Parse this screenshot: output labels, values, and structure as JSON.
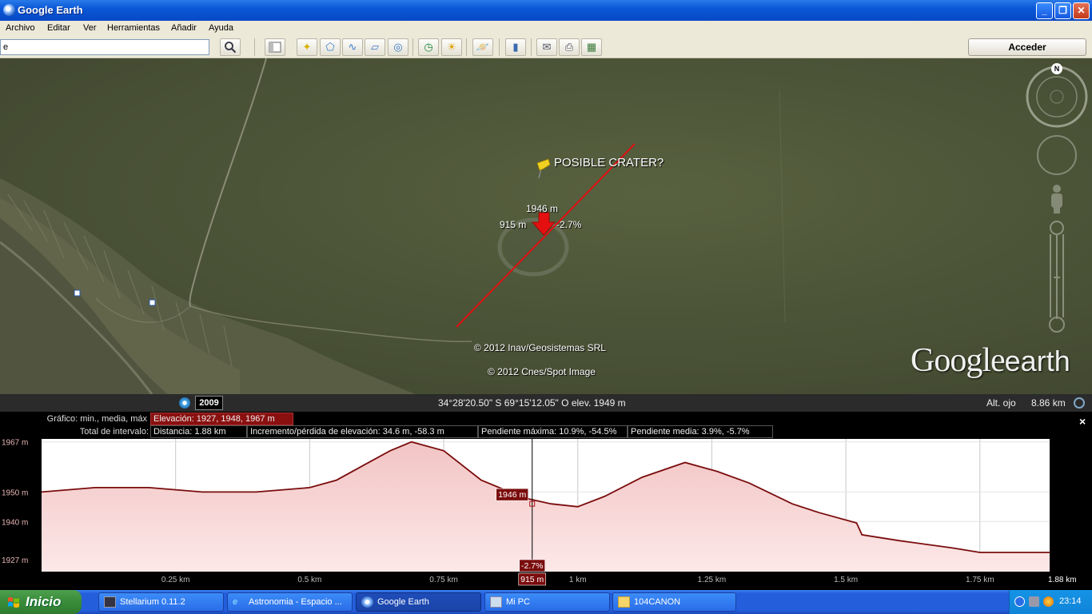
{
  "window": {
    "title": "Google Earth",
    "controls": [
      "_",
      "❐",
      "✕"
    ]
  },
  "menu": [
    "Archivo",
    "Editar",
    "Ver",
    "Herramientas",
    "Añadir",
    "Ayuda"
  ],
  "toolbar": {
    "search_value": "e",
    "signin_label": "Acceder"
  },
  "map": {
    "placemark_label": "POSIBLE CRATER?",
    "cursor_elevation": "1946 m",
    "cursor_distance": "915 m",
    "cursor_slope": "-2.7%",
    "copyright_1": "© 2012 Inav/Geosistemas SRL",
    "copyright_2": "© 2012 Cnes/Spot Image",
    "brand_google": "Google",
    "brand_earth": "earth",
    "compass_north": "N"
  },
  "status": {
    "year": "2009",
    "coordinates": "34°28'20.50\" S  69°15'12.05\" O elev.  1949 m",
    "eye_alt_label": "Alt. ojo",
    "eye_alt_value": "8.86 km"
  },
  "profile": {
    "graph_label": "Gráfico: min., media, máx",
    "elevation_stats": "Elevación: 1927, 1948, 1967 m",
    "range_label": "Total de intervalo:",
    "distance": "Distancia: 1.88 km",
    "gain_loss": "Incremento/pérdida de elevación: 34.6 m, -58.3 m",
    "max_slope": "Pendiente máxima: 10.9%, -54.5%",
    "avg_slope": "Pendiente media: 3.9%, -5.7%",
    "close_label": "×",
    "cursor_elevation": "1946 m",
    "cursor_slope": "-2.7%",
    "cursor_distance": "915 m"
  },
  "chart_data": {
    "type": "area",
    "xlabel": "",
    "ylabel": "",
    "x_ticks": [
      {
        "value": 0.25,
        "label": "0.25 km"
      },
      {
        "value": 0.5,
        "label": "0.5 km"
      },
      {
        "value": 0.75,
        "label": "0.75 km"
      },
      {
        "value": 1.0,
        "label": "1 km"
      },
      {
        "value": 1.25,
        "label": "1.25 km"
      },
      {
        "value": 1.5,
        "label": "1.5 km"
      },
      {
        "value": 1.75,
        "label": "1.75 km"
      },
      {
        "value": 1.88,
        "label": "1.88 km"
      }
    ],
    "y_ticks": [
      {
        "value": 1967,
        "label": "1967 m"
      },
      {
        "value": 1950,
        "label": "1950 m"
      },
      {
        "value": 1940,
        "label": "1940 m"
      },
      {
        "value": 1927,
        "label": "1927 m"
      }
    ],
    "xlim": [
      0,
      1.88
    ],
    "ylim": [
      1923,
      1968
    ],
    "series": [
      {
        "x": [
          0,
          0.1,
          0.2,
          0.3,
          0.4,
          0.5,
          0.55,
          0.6,
          0.65,
          0.69,
          0.75,
          0.82,
          0.9,
          0.95,
          1.0,
          1.05,
          1.12,
          1.2,
          1.26,
          1.32,
          1.4,
          1.45,
          1.52,
          1.53,
          1.6,
          1.7,
          1.75,
          1.88
        ],
        "y": [
          1950,
          1951.5,
          1951.5,
          1950,
          1950,
          1951.5,
          1954,
          1959,
          1964,
          1967,
          1964,
          1954,
          1948,
          1946,
          1945,
          1948.5,
          1955,
          1960,
          1957,
          1953,
          1946,
          1943,
          1939.5,
          1935.5,
          1933.5,
          1931,
          1929.5,
          1929.5
        ]
      }
    ],
    "cursor": {
      "x": 0.915,
      "y": 1946
    }
  },
  "taskbar": {
    "start_label": "Inicio",
    "tasks": [
      "Stellarium 0.11.2",
      "Astronomia - Espacio ...",
      "Google Earth",
      "Mi PC",
      "104CANON"
    ],
    "clock": "23:14"
  }
}
